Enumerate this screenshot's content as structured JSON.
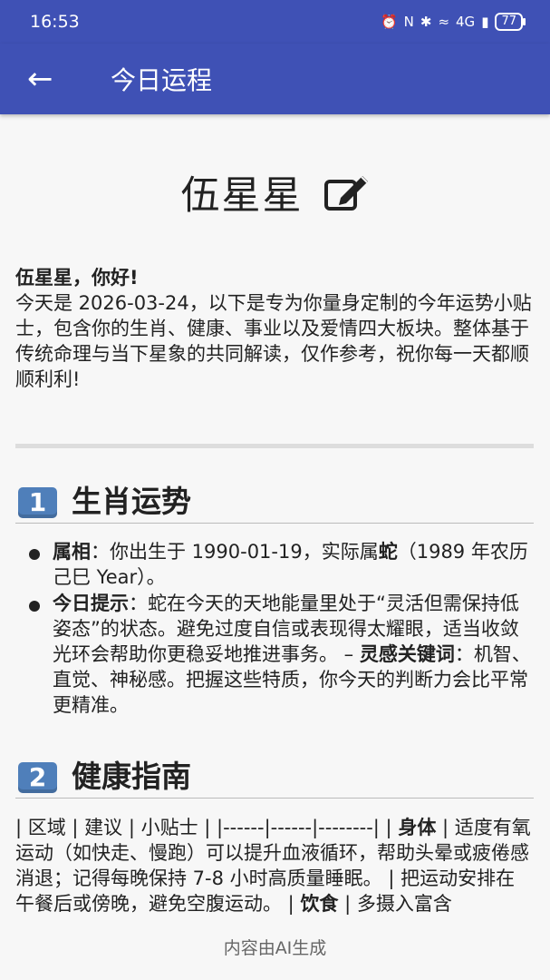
{
  "status": {
    "time": "16:53",
    "battery": "77",
    "signal": "4G"
  },
  "app_bar": {
    "title": "今日运程"
  },
  "user": {
    "name": "伍星星"
  },
  "intro": {
    "greeting": "伍星星，你好!",
    "text": "今天是 2026-03-24，以下是专为你量身定制的今年运势小贴士，包含你的生肖、健康、事业以及爱情四大板块。整体基于传统命理与当下星象的共同解读，仅作参考，祝你每一天都顺顺利利!"
  },
  "section1": {
    "num": "1",
    "title": "生肖运势",
    "b1_key": "属相",
    "b1_text_a": "：你出生于 1990-01-19，实际属",
    "b1_strong": "蛇",
    "b1_text_b": "（1989 年农历己巳 Year）。",
    "b2_key": "今日提示",
    "b2_text_a": "：蛇在今天的天地能量里处于“灵活但需保持低姿态”的状态。避免过度自信或表现得太耀眼，适当收敛光环会帮助你更稳妥地推进事务。  –",
    "b2_strong": "灵感关键词",
    "b2_text_b": "：机智、直觉、神秘感。把握这些特质，你今天的判断力会比平常更精准。"
  },
  "section2": {
    "num": "2",
    "title": "健康指南",
    "table_line": "| 区域 | 建议 | 小贴士 | |------|------|--------| |",
    "body_key": "身体",
    "body_text": "| 适度有氧运动（如快走、慢跑）可以提升血液循环，帮助头晕或疲倦感消退；记得每晚保持 7-8 小时高质量睡眠。 | 把运动安排在午餐后或傍晚，避免空腹运动。 |",
    "diet_key": "饮食",
    "diet_text": "| 多摄入富含"
  },
  "footer": {
    "text": "内容由AI生成"
  },
  "icons": {
    "back": "arrow-left-icon",
    "edit": "edit-pencil-icon"
  },
  "colors": {
    "primary": "#3f51b5",
    "section_badge": "#4f7fba"
  }
}
